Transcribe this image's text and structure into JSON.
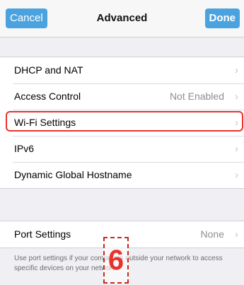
{
  "navbar": {
    "cancel_label": "Cancel",
    "title": "Advanced",
    "done_label": "Done"
  },
  "group1": {
    "rows": [
      {
        "label": "DHCP and NAT",
        "value": ""
      },
      {
        "label": "Access Control",
        "value": "Not Enabled"
      },
      {
        "label": "Wi-Fi Settings",
        "value": ""
      },
      {
        "label": "IPv6",
        "value": ""
      },
      {
        "label": "Dynamic Global Hostname",
        "value": ""
      }
    ]
  },
  "group2": {
    "rows": [
      {
        "label": "Port Settings",
        "value": "None"
      }
    ],
    "footer": "Use port settings if your computers outside your network to access specific devices on your network."
  },
  "annotation": {
    "step_number": "6",
    "highlight_color": "#e8332a"
  },
  "icons": {
    "chevron": "chevron-right-icon"
  }
}
